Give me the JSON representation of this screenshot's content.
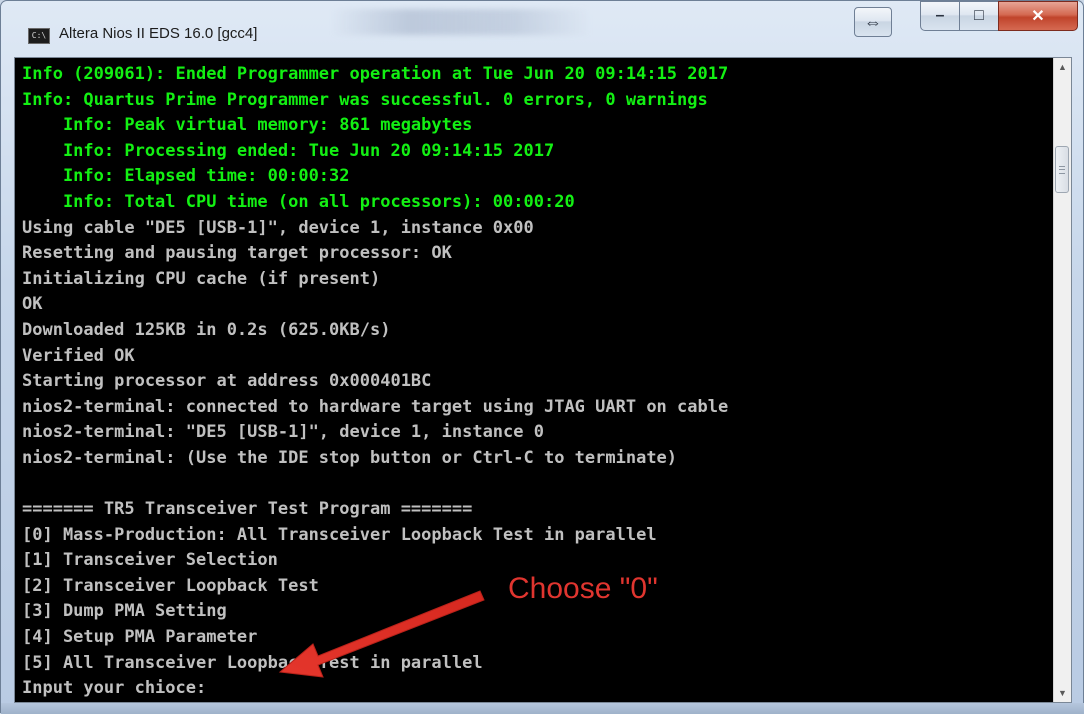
{
  "window": {
    "title": "Altera Nios II EDS 16.0 [gcc4]",
    "icon_text": "C:\\",
    "buttons": {
      "snap_icon": "⇔",
      "minimize_icon": "–",
      "maximize_icon": "□",
      "close_icon": "✕"
    }
  },
  "console": {
    "lines": [
      {
        "text": "Info (209061): Ended Programmer operation at Tue Jun 20 09:14:15 2017",
        "color": "green"
      },
      {
        "text": "Info: Quartus Prime Programmer was successful. 0 errors, 0 warnings",
        "color": "green"
      },
      {
        "text": "    Info: Peak virtual memory: 861 megabytes",
        "color": "green"
      },
      {
        "text": "    Info: Processing ended: Tue Jun 20 09:14:15 2017",
        "color": "green"
      },
      {
        "text": "    Info: Elapsed time: 00:00:32",
        "color": "green"
      },
      {
        "text": "    Info: Total CPU time (on all processors): 00:00:20",
        "color": "green"
      },
      {
        "text": "Using cable \"DE5 [USB-1]\", device 1, instance 0x00",
        "color": "gray"
      },
      {
        "text": "Resetting and pausing target processor: OK",
        "color": "gray"
      },
      {
        "text": "Initializing CPU cache (if present)",
        "color": "gray"
      },
      {
        "text": "OK",
        "color": "gray"
      },
      {
        "text": "Downloaded 125KB in 0.2s (625.0KB/s)",
        "color": "gray"
      },
      {
        "text": "Verified OK",
        "color": "gray"
      },
      {
        "text": "Starting processor at address 0x000401BC",
        "color": "gray"
      },
      {
        "text": "nios2-terminal: connected to hardware target using JTAG UART on cable",
        "color": "gray"
      },
      {
        "text": "nios2-terminal: \"DE5 [USB-1]\", device 1, instance 0",
        "color": "gray"
      },
      {
        "text": "nios2-terminal: (Use the IDE stop button or Ctrl-C to terminate)",
        "color": "gray"
      },
      {
        "text": "",
        "color": "gray"
      },
      {
        "text": "======= TR5 Transceiver Test Program =======",
        "color": "gray"
      },
      {
        "text": "[0] Mass-Production: All Transceiver Loopback Test in parallel",
        "color": "gray"
      },
      {
        "text": "[1] Transceiver Selection",
        "color": "gray"
      },
      {
        "text": "[2] Transceiver Loopback Test",
        "color": "gray"
      },
      {
        "text": "[3] Dump PMA Setting",
        "color": "gray"
      },
      {
        "text": "[4] Setup PMA Parameter",
        "color": "gray"
      },
      {
        "text": "[5] All Transceiver Loopback Test in parallel",
        "color": "gray"
      },
      {
        "text": "Input your chioce:",
        "color": "gray"
      }
    ],
    "colors": {
      "green": "#13f013",
      "gray": "#c0c0c0",
      "background": "#000000"
    }
  },
  "scrollbar": {
    "up_icon": "▲",
    "down_icon": "▼"
  },
  "annotation": {
    "text": "Choose \"0\"",
    "color": "#e0352f"
  }
}
